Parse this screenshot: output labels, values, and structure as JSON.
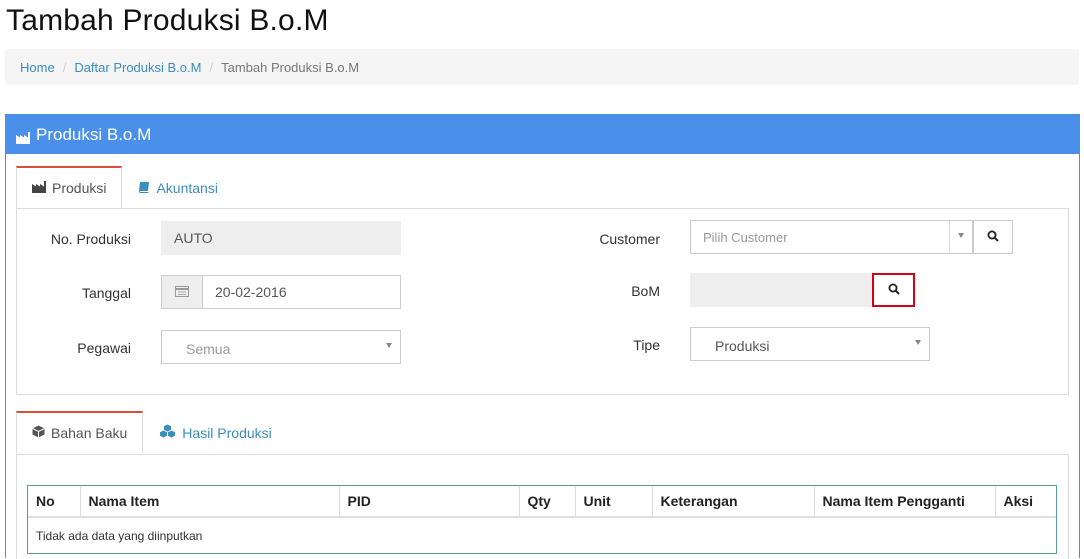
{
  "page": {
    "title": "Tambah Produksi B.o.M"
  },
  "breadcrumb": {
    "items": [
      "Home",
      "Daftar Produksi B.o.M",
      "Tambah Produksi B.o.M"
    ]
  },
  "panel": {
    "title": "Produksi B.o.M"
  },
  "tabs_top": [
    {
      "label": "Produksi",
      "icon": "factory-icon"
    },
    {
      "label": "Akuntansi",
      "icon": "book-icon"
    }
  ],
  "form": {
    "no_produksi": {
      "label": "No. Produksi",
      "value": "AUTO"
    },
    "tanggal": {
      "label": "Tanggal",
      "value": "20-02-2016"
    },
    "pegawai": {
      "label": "Pegawai",
      "value": "Semua"
    },
    "customer": {
      "label": "Customer",
      "placeholder": "Pilih Customer"
    },
    "bom": {
      "label": "BoM",
      "value": ""
    },
    "tipe": {
      "label": "Tipe",
      "value": "Produksi"
    }
  },
  "tabs_bottom": [
    {
      "label": "Bahan Baku",
      "icon": "cube-icon"
    },
    {
      "label": "Hasil Produksi",
      "icon": "cubes-icon"
    }
  ],
  "table": {
    "columns": [
      "No",
      "Nama Item",
      "PID",
      "Qty",
      "Unit",
      "Keterangan",
      "Nama Item Pengganti",
      "Aksi"
    ],
    "empty_text": "Tidak ada data yang diinputkan"
  },
  "colors": {
    "panel_header": "#4a90ea",
    "active_tab_border": "#dd4b39",
    "link": "#3c8dbc",
    "highlight": "#d0021b"
  }
}
